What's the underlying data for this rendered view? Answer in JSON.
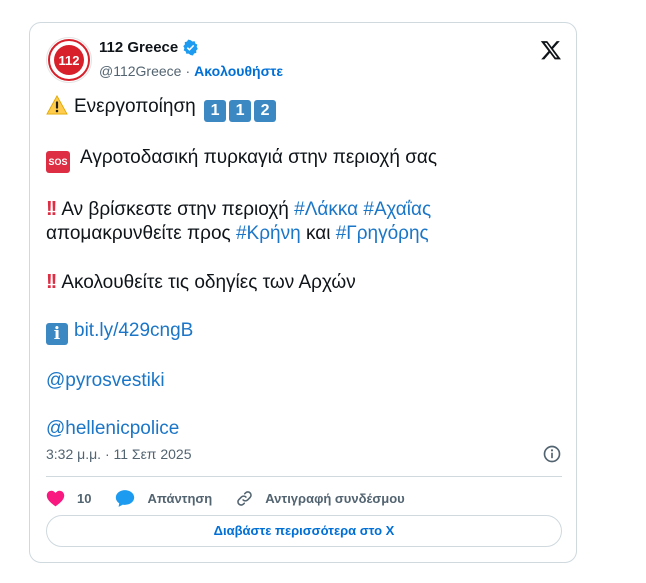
{
  "tweet": {
    "display_name": "112 Greece",
    "handle": "@112Greece",
    "separator": "·",
    "follow_label": "Ακολουθήστε",
    "avatar_text": "112",
    "lines": {
      "l1": "Ενεργοποίηση",
      "l1_digits": [
        "1",
        "1",
        "2"
      ],
      "sos_badge": "SOS",
      "l2": "Αγροτοδασική πυρκαγιά στην περιοχή σας",
      "l3a": "Αν βρίσκεστε στην περιοχή",
      "tag_lakka": "#Λάκκα",
      "tag_achaias": "#Αχαΐας",
      "l4a": "απομακρυνθείτε προς",
      "tag_krini": "#Κρήνη",
      "l4b": "και",
      "tag_grigoris": "#Γρηγόρης",
      "l5": "Ακολουθείτε τις οδηγίες των Αρχών",
      "info_badge": "i",
      "link": "bit.ly/429cngB",
      "mention1": "@pyrosvestiki",
      "mention2": "@hellenicpolice"
    },
    "timestamp": "3:32 μ.μ. · 11 Σεπ 2025",
    "likes": "10",
    "reply_label": "Απάντηση",
    "copy_link_label": "Αντιγραφή συνδέσμου",
    "read_more_label": "Διαβάστε περισσότερα στο X"
  },
  "colors": {
    "link": "#1b76c7",
    "accent": "#006fd6",
    "like": "#f91880",
    "reply": "#1d9bf0",
    "border": "#cfd9de",
    "muted": "#536471"
  },
  "icons": {
    "verified": "verified-badge-icon",
    "x_logo": "x-logo-icon",
    "warning": "warning-icon",
    "info": "info-circle-icon",
    "heart": "heart-icon",
    "reply": "reply-bubble-icon",
    "link": "link-icon"
  }
}
